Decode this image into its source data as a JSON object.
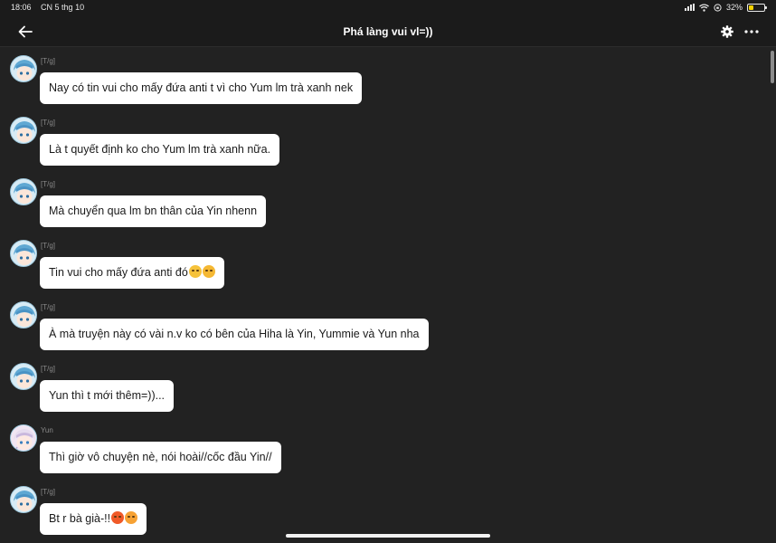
{
  "status_bar": {
    "time": "18:06",
    "date": "CN 5 thg 10",
    "battery": "32%",
    "battery_level": 0.32
  },
  "header": {
    "title": "Phá làng vui vl=))",
    "icons": [
      "back-arrow-icon",
      "gear-icon",
      "more-icon"
    ]
  },
  "messages": [
    {
      "sender": "[T/g]",
      "text": "Nay có tin vui cho mấy đứa anti t vì cho Yum lm trà xanh nek",
      "emojis": []
    },
    {
      "sender": "[T/g]",
      "text": "Là t quyết định ko cho Yum lm trà xanh nữa.",
      "emojis": []
    },
    {
      "sender": "[T/g]",
      "text": "Mà chuyển qua lm bn thân của Yin nhenn",
      "emojis": []
    },
    {
      "sender": "[T/g]",
      "text": "Tin vui cho mấy đứa anti đó",
      "emojis": [
        "partying-face-emoji",
        "relieved-face-emoji"
      ]
    },
    {
      "sender": "[T/g]",
      "text": "À mà truyện này có vài n.v ko có bên của Hiha là Yin, Yummie và Yun nha",
      "emojis": []
    },
    {
      "sender": "[T/g]",
      "text": "Yun thì t mới thêm=))...",
      "emojis": []
    },
    {
      "sender": "Yun",
      "text": "Thì giờ vô chuyện nè, nói hoài//cốc đầu Yin//",
      "emojis": []
    },
    {
      "sender": "[T/g]",
      "text": "Bt r bà già-!!",
      "emojis": [
        "angry-face-emoji",
        "angry-face-emoji"
      ]
    }
  ],
  "colors": {
    "background": "#222222",
    "bubble": "#ffffff",
    "header": "#1b1b1b",
    "sender_text": "#8a8a8a"
  }
}
